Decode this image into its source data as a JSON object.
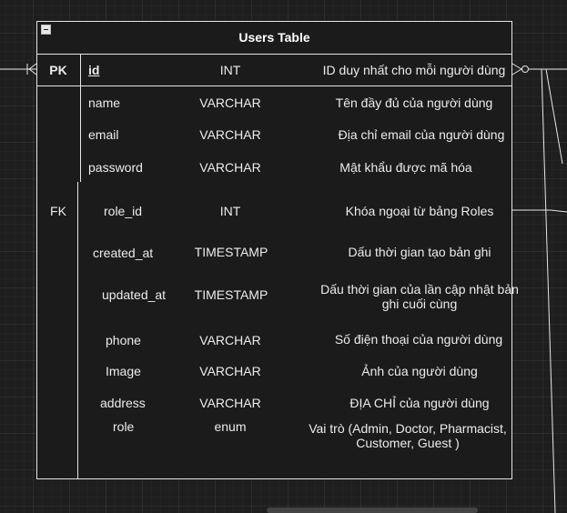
{
  "table": {
    "title": "Users Table",
    "rows": [
      {
        "key": "PK",
        "name": "id",
        "type": "INT",
        "desc": "ID duy nhất cho mỗi người dùng"
      },
      {
        "key": "",
        "name": "name",
        "type": "VARCHAR",
        "desc": "Tên đầy đủ của người dùng"
      },
      {
        "key": "",
        "name": "email",
        "type": "VARCHAR",
        "desc": "Địa chỉ email của người dùng"
      },
      {
        "key": "",
        "name": "password",
        "type": "VARCHAR",
        "desc": "Mật khẩu được mã hóa"
      },
      {
        "key": "FK",
        "name": "role_id",
        "type": "INT",
        "desc": "Khóa ngoại từ bảng Roles"
      },
      {
        "key": "",
        "name": "created_at",
        "type": "TIMESTAMP",
        "desc": "Dấu thời gian tạo bản ghi"
      },
      {
        "key": "",
        "name": "updated_at",
        "type": "TIMESTAMP",
        "desc": "Dấu thời gian của lần cập nhật bản ghi cuối cùng"
      },
      {
        "key": "",
        "name": "phone",
        "type": "VARCHAR",
        "desc": "Số điện thoại của người dùng"
      },
      {
        "key": "",
        "name": "Image",
        "type": "VARCHAR",
        "desc": "Ảnh của người dùng"
      },
      {
        "key": "",
        "name": "address",
        "type": "VARCHAR",
        "desc": "ĐỊA CHỈ của người dùng"
      },
      {
        "key": "",
        "name": "role",
        "type": "enum",
        "desc": "Vai trò (Admin, Doctor, Pharmacist, Customer, Guest )"
      }
    ]
  },
  "colors": {
    "background": "#1e1e1e",
    "border": "#e6e6e6",
    "text": "#ececec"
  }
}
